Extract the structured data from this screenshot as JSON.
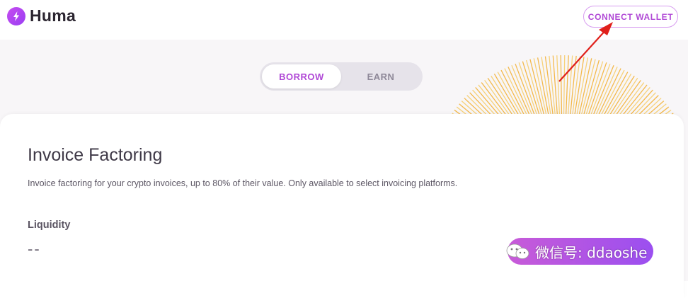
{
  "app": {
    "name": "Huma"
  },
  "header": {
    "connect_wallet_label": "CONNECT WALLET"
  },
  "tabs": [
    {
      "label": "BORROW",
      "selected": true
    },
    {
      "label": "EARN",
      "selected": false
    }
  ],
  "card": {
    "title": "Invoice Factoring",
    "description": "Invoice factoring for your crypto invoices, up to 80% of their value. Only available to select invoicing platforms.",
    "liquidity_label": "Liquidity",
    "liquidity_value": "--"
  },
  "watermark": {
    "text": "微信号: ddaoshe"
  },
  "colors": {
    "accent": "#b048d6",
    "gradient_start": "#c85bd8",
    "gradient_end": "#9b4ff0",
    "sunburst": "#f6c95c",
    "arrow": "#e0201b"
  },
  "icons": [
    "huma-logo-icon",
    "wechat-icon"
  ]
}
